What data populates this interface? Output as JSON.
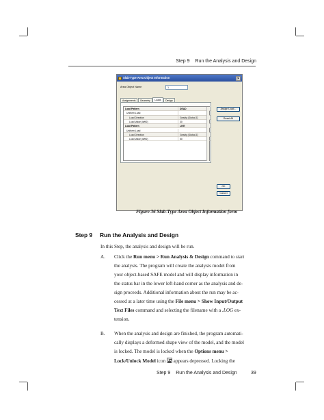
{
  "running_head": {
    "step": "Step 9",
    "title": "Run the Analysis and Design"
  },
  "figure": {
    "dialog": {
      "title": "Slab-Type Area Object Information",
      "close_glyph": "×",
      "name_label": "Area Object Name",
      "name_value": "1",
      "tabs": [
        {
          "label": "Assignments",
          "active": false
        },
        {
          "label": "Geometry",
          "active": false
        },
        {
          "label": "Loads",
          "active": true
        },
        {
          "label": "Design",
          "active": false
        }
      ],
      "rows": [
        {
          "c1": "Load Pattern",
          "c2": "DEAD",
          "style": "bold"
        },
        {
          "c1": "Uniform Load",
          "c2": "",
          "style": "indent"
        },
        {
          "c1": "Load Direction",
          "c2": "Gravity (Global Z)",
          "style": "indent2"
        },
        {
          "c1": "Load Value  (lb/ft2)",
          "c2": "30",
          "style": "indent2"
        },
        {
          "c1": "Load Pattern",
          "c2": "LIVE",
          "style": "bold"
        },
        {
          "c1": "Uniform Load",
          "c2": "",
          "style": "indent"
        },
        {
          "c1": "Load Direction",
          "c2": "Gravity (Global Z)",
          "style": "indent2"
        },
        {
          "c1": "Load Value  (lb/ft2)",
          "c2": "50",
          "style": "indent2"
        }
      ],
      "buttons": {
        "assign_load": "Assign Load...",
        "reset_all": "Reset All",
        "ok": "OK",
        "cancel": "Cancel"
      }
    },
    "caption": "Figure 36 Slab-Type Area Object Information form"
  },
  "section": {
    "label": "Step 9",
    "title": "Run the Analysis and Design",
    "intro": "In this Step, the analysis and design will be run."
  },
  "items": {
    "a": {
      "letter": "A.",
      "lines": {
        "l1_pre": "Click the ",
        "l1_bold": "Run menu > Run Analysis & Design",
        "l1_post": " command to start",
        "l2": "the analysis. The program will create the analysis model from",
        "l3": "your object-based SAFE model and will display information in",
        "l4": "the status bar in the lower left-hand corner as the analysis and de-",
        "l5": "sign proceeds. Additional information about the run may be ac-",
        "l6_pre": "cessed at a later time using the ",
        "l6_bold": "File menu > Show Input/Output",
        "l7_bold": "Text Files",
        "l7_mid": " command and selecting the filename with a ",
        "l7_ital": ".LOG",
        "l7_post": " ex-",
        "l8": "tension."
      }
    },
    "b": {
      "letter": "B.",
      "lines": {
        "l1": "When the analysis and design are finished, the program automati-",
        "l2": "cally displays a deformed shape view of the model, and the model",
        "l3_pre": "is locked. The model is locked when the ",
        "l3_bold": "Options menu >",
        "l4_bold": "Lock/Unlock Model",
        "l4_mid": " icon ",
        "l4_post": " appears depressed. Locking the",
        "icon": "lock-icon"
      }
    }
  },
  "footer": {
    "step": "Step 9",
    "title": "Run the Analysis and Design",
    "page": "39"
  }
}
